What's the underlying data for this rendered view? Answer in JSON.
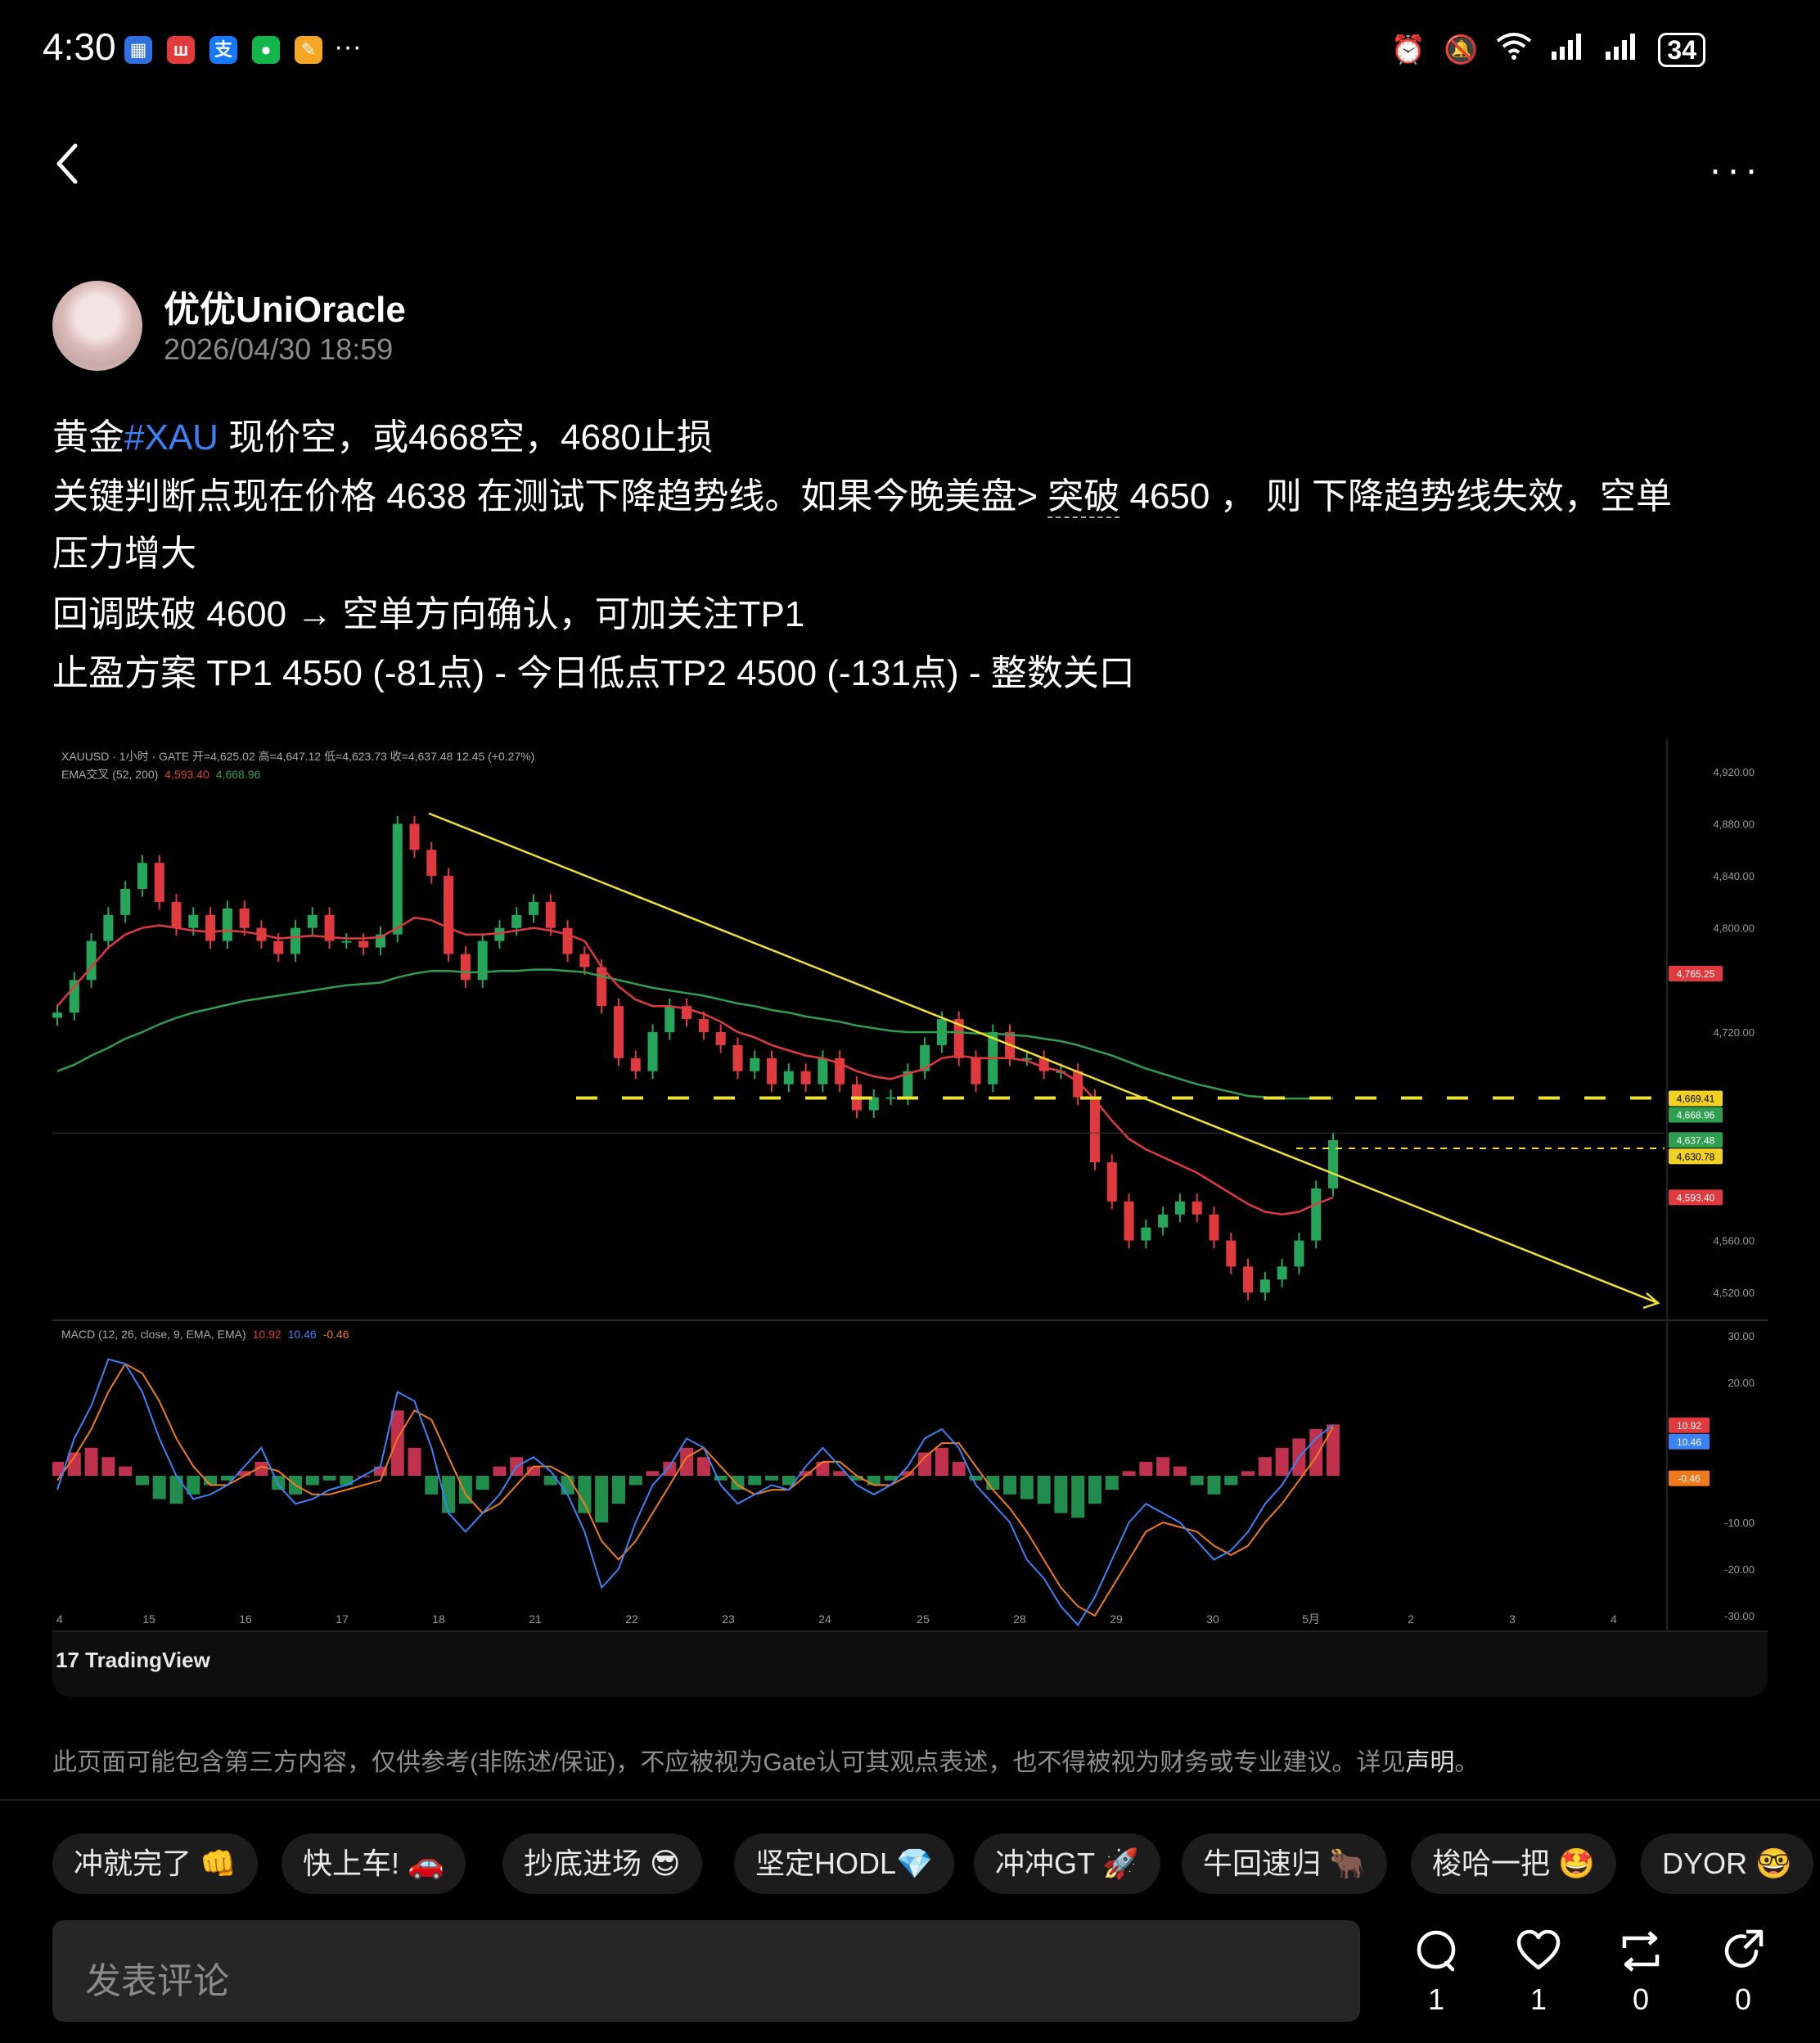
{
  "status_bar": {
    "time": "4:30",
    "more_dots": "···",
    "battery": "34"
  },
  "header": {
    "more": "···"
  },
  "author": {
    "name": "优优UniOracle",
    "timestamp": "2026/04/30 18:59"
  },
  "post": {
    "line1_a": "黄金",
    "line1_tag": "#XAU",
    "line1_b": " 现价空，或4668空，4680止损",
    "line2_a": "关键判断点现在价格 4638 在测试下降趋势线。如果今晚美盘> ",
    "line2_b": "突破",
    "line2_c": " 4650 ， 则 下降趋势线失效，空单",
    "line3": "压力增大",
    "line4": "回调跌破 4600 → 空单方向确认，可加关注TP1",
    "line5": "止盈方案 TP1 4550 (-81点) - 今日低点TP2 4500 (-131点) - 整数关口"
  },
  "chart_data": {
    "type": "candlestick",
    "header_line": "XAUUSD · 1小时 · GATE  开=4,625.02  高=4,647.12  低=4,623.73  收=4,637.48  12.45 (+0.27%)",
    "ema_line_label": "EMA交叉 (52, 200)",
    "ema_fast_value": "4,593.40",
    "ema_slow_value": "4,668.96",
    "macd_label": "MACD (12, 26, close, 9, EMA, EMA)",
    "macd_values": [
      "10.92",
      "10.46",
      "-0.46"
    ],
    "price_ticks": [
      "4,920.00",
      "4,880.00",
      "4,840.00",
      "4,800.00",
      "4,720.00",
      "4,560.00",
      "4,520.00"
    ],
    "price_tick_values": [
      4920,
      4880,
      4840,
      4800,
      4720,
      4560,
      4520
    ],
    "price_tags": [
      {
        "text": "4,765.25",
        "value": 4765.25,
        "color": "#e03a3e"
      },
      {
        "text": "4,669.41",
        "value": 4669.41,
        "color": "#f0d020"
      },
      {
        "text": "4,668.96",
        "value": 4668.96,
        "color": "#2e9e4f"
      },
      {
        "text": "4,637.48",
        "value": 4637.48,
        "color": "#2e9e4f"
      },
      {
        "text": "4,630.78",
        "value": 4630.78,
        "color": "#f0d020"
      },
      {
        "text": "4,593.40",
        "value": 4593.4,
        "color": "#e03a3e"
      }
    ],
    "macd_ticks": [
      "30.00",
      "20.00",
      "-10.00",
      "-20.00",
      "-30.00"
    ],
    "macd_tick_values": [
      30,
      20,
      -10,
      -20,
      -30
    ],
    "macd_tags": [
      {
        "text": "10.92",
        "value": 10.92,
        "color": "#e03a3e"
      },
      {
        "text": "10.46",
        "value": 10.46,
        "color": "#3b82f6"
      },
      {
        "text": "-0.46",
        "value": -0.46,
        "color": "#f07a1a"
      }
    ],
    "x_ticks": [
      "4",
      "15",
      "16",
      "17",
      "18",
      "21",
      "22",
      "23",
      "24",
      "25",
      "28",
      "29",
      "30",
      "5月",
      "2",
      "3",
      "4"
    ],
    "y_range": [
      4500,
      4940
    ],
    "macd_range": [
      -33,
      33
    ],
    "close_path": [
      4735,
      4760,
      4790,
      4810,
      4830,
      4850,
      4820,
      4800,
      4810,
      4790,
      4815,
      4800,
      4790,
      4780,
      4800,
      4810,
      4790,
      4790,
      4785,
      4795,
      4880,
      4860,
      4840,
      4780,
      4760,
      4790,
      4800,
      4810,
      4820,
      4800,
      4780,
      4770,
      4740,
      4700,
      4690,
      4720,
      4740,
      4730,
      4720,
      4710,
      4690,
      4700,
      4680,
      4690,
      4680,
      4700,
      4680,
      4660,
      4670,
      4670,
      4690,
      4710,
      4730,
      4700,
      4680,
      4720,
      4700,
      4700,
      4690,
      4690,
      4670,
      4620,
      4590,
      4560,
      4570,
      4580,
      4590,
      4580,
      4560,
      4540,
      4520,
      4530,
      4540,
      4560,
      4600,
      4637
    ],
    "ema52_path": [
      4740,
      4755,
      4770,
      4785,
      4795,
      4800,
      4802,
      4800,
      4798,
      4797,
      4798,
      4797,
      4795,
      4792,
      4793,
      4794,
      4793,
      4792,
      4792,
      4793,
      4800,
      4808,
      4806,
      4800,
      4795,
      4795,
      4796,
      4798,
      4800,
      4798,
      4795,
      4790,
      4770,
      4755,
      4745,
      4740,
      4740,
      4738,
      4734,
      4728,
      4720,
      4716,
      4710,
      4706,
      4702,
      4700,
      4696,
      4690,
      4686,
      4684,
      4688,
      4692,
      4700,
      4702,
      4700,
      4700,
      4700,
      4698,
      4693,
      4690,
      4682,
      4668,
      4652,
      4638,
      4630,
      4624,
      4618,
      4612,
      4604,
      4596,
      4588,
      4582,
      4580,
      4582,
      4588,
      4593
    ],
    "ema200_path": [
      4690,
      4695,
      4702,
      4708,
      4715,
      4720,
      4726,
      4731,
      4735,
      4738,
      4741,
      4744,
      4746,
      4748,
      4750,
      4752,
      4754,
      4756,
      4757,
      4758,
      4762,
      4765,
      4767,
      4767,
      4766,
      4766,
      4767,
      4767,
      4768,
      4768,
      4767,
      4766,
      4763,
      4760,
      4757,
      4754,
      4752,
      4750,
      4748,
      4745,
      4742,
      4740,
      4737,
      4735,
      4732,
      4730,
      4728,
      4725,
      4723,
      4721,
      4720,
      4720,
      4720,
      4720,
      4719,
      4719,
      4718,
      4717,
      4715,
      4713,
      4710,
      4706,
      4702,
      4697,
      4692,
      4688,
      4684,
      4680,
      4677,
      4674,
      4671,
      4670,
      4669,
      4669,
      4669,
      4669
    ],
    "resistance_level": 4669.41,
    "current_level": 4630.78,
    "trendline": {
      "start_value": 4888,
      "end_value": 4512
    },
    "macd_hist": [
      3,
      5,
      6,
      4,
      2,
      -2,
      -5,
      -6,
      -4,
      -2,
      -1,
      1,
      3,
      -3,
      -4,
      -2,
      -1,
      -2,
      0,
      2,
      14,
      6,
      -4,
      -8,
      -6,
      -3,
      2,
      4,
      2,
      -2,
      -4,
      -8,
      -10,
      -6,
      -2,
      1,
      3,
      6,
      4,
      -1,
      -3,
      -2,
      -1,
      -2,
      1,
      3,
      1,
      -1,
      -2,
      -1,
      1,
      5,
      6,
      3,
      -1,
      -3,
      -4,
      -5,
      -6,
      -8,
      -9,
      -6,
      -3,
      1,
      3,
      4,
      2,
      -2,
      -4,
      -2,
      1,
      4,
      6,
      8,
      10,
      11
    ],
    "macd_line": [
      -3,
      8,
      15,
      25,
      24,
      18,
      8,
      0,
      -5,
      -4,
      -2,
      2,
      6,
      -2,
      -6,
      -5,
      -3,
      -2,
      0,
      2,
      18,
      16,
      6,
      -8,
      -12,
      -8,
      -4,
      2,
      4,
      1,
      -4,
      -12,
      -24,
      -20,
      -10,
      -2,
      2,
      8,
      6,
      -2,
      -6,
      -4,
      -2,
      -3,
      2,
      6,
      2,
      -2,
      -4,
      -2,
      2,
      8,
      10,
      6,
      -2,
      -6,
      -10,
      -18,
      -22,
      -28,
      -32,
      -26,
      -18,
      -10,
      -6,
      -8,
      -10,
      -14,
      -18,
      -16,
      -12,
      -6,
      -2,
      4,
      8,
      10.92
    ],
    "signal_line": [
      -1,
      4,
      10,
      18,
      24,
      22,
      16,
      8,
      2,
      -2,
      -2,
      0,
      2,
      1,
      -2,
      -4,
      -4,
      -3,
      -2,
      -1,
      8,
      14,
      12,
      4,
      -4,
      -8,
      -6,
      -2,
      2,
      2,
      0,
      -6,
      -14,
      -18,
      -14,
      -8,
      -2,
      4,
      6,
      2,
      -2,
      -4,
      -3,
      -3,
      0,
      3,
      3,
      0,
      -2,
      -2,
      0,
      4,
      7,
      7,
      2,
      -3,
      -7,
      -12,
      -18,
      -24,
      -28,
      -30,
      -24,
      -18,
      -12,
      -10,
      -11,
      -12,
      -15,
      -17,
      -15,
      -10,
      -6,
      -1,
      4,
      10.46
    ]
  },
  "tradingview_logo": "17 TradingView",
  "disclaimer": {
    "text": "此页面可能包含第三方内容，仅供参考(非陈述/保证)，不应被视为Gate认可其观点表述，也不得被视为财务或专业建议。详见",
    "link": "声明",
    "end": "。"
  },
  "chips": [
    "冲就完了 👊",
    "快上车! 🚗",
    "抄底进场 😎",
    "坚定HODL💎",
    "冲冲GT 🚀",
    "牛回速归 🐂",
    "梭哈一把 🤩",
    "DYOR 🤓"
  ],
  "comment": {
    "placeholder": "发表评论"
  },
  "actions": {
    "comments": "1",
    "likes": "1",
    "reposts": "0",
    "shares": "0"
  },
  "colors": {
    "background": "#000000",
    "up": "#26a65b",
    "down": "#e03a3e",
    "trendline": "#f0e030",
    "ema_fast": "#e03a3e",
    "ema_slow": "#2e9e4f",
    "hashtag": "#3b82f6"
  }
}
